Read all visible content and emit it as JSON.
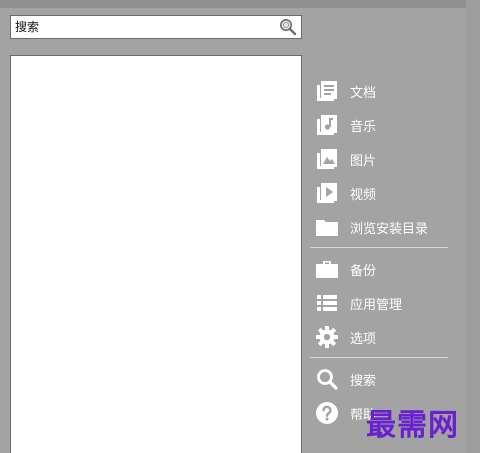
{
  "search": {
    "placeholder": "搜索",
    "icon": "magnifier-icon"
  },
  "menu": {
    "group1": [
      {
        "id": "documents",
        "label": "文档",
        "icon": "document-icon"
      },
      {
        "id": "music",
        "label": "音乐",
        "icon": "music-icon"
      },
      {
        "id": "pictures",
        "label": "图片",
        "icon": "image-icon"
      },
      {
        "id": "video",
        "label": "视频",
        "icon": "video-icon"
      },
      {
        "id": "browse",
        "label": "浏览安装目录",
        "icon": "folder-icon"
      }
    ],
    "group2": [
      {
        "id": "backup",
        "label": "备份",
        "icon": "briefcase-icon"
      },
      {
        "id": "app-manage",
        "label": "应用管理",
        "icon": "list-icon"
      },
      {
        "id": "options",
        "label": "选项",
        "icon": "gear-icon"
      }
    ],
    "group3": [
      {
        "id": "search",
        "label": "搜索",
        "icon": "search-icon"
      },
      {
        "id": "help",
        "label": "帮助",
        "icon": "help-icon"
      }
    ]
  },
  "watermark": "最需网",
  "colors": {
    "background": "#a3a3a3",
    "pane": "#ffffff",
    "menu_text": "#ffffff",
    "watermark": "#6a1fd0"
  }
}
